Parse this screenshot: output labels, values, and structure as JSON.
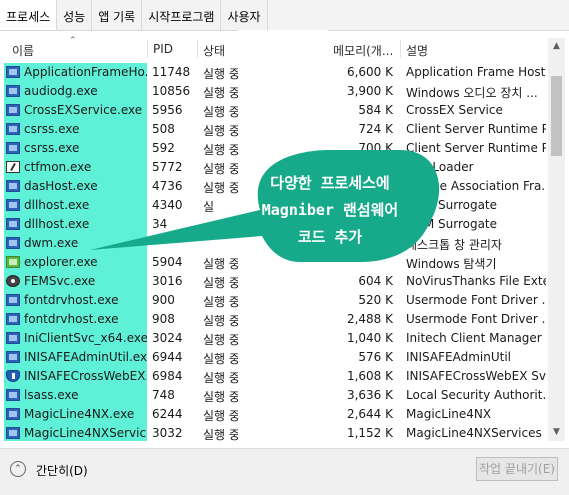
{
  "tabs": [
    "프로세스",
    "성능",
    "앱 기록",
    "시작프로그램",
    "사용자"
  ],
  "columns": {
    "name": "이름",
    "pid": "PID",
    "status": "상태",
    "memory": "메모리(개...",
    "description": "설명"
  },
  "rows": [
    {
      "name": "ApplicationFrameHo...",
      "pid": "11748",
      "status": "실행 중",
      "memory": "6,600 K",
      "desc": "Application Frame Host",
      "icon": "app-window-icon"
    },
    {
      "name": "audiodg.exe",
      "pid": "10856",
      "status": "실행 중",
      "memory": "3,900 K",
      "desc": "Windows 오디오 장치 ...",
      "icon": "app-window-icon"
    },
    {
      "name": "CrossEXService.exe",
      "pid": "5956",
      "status": "실행 중",
      "memory": "584 K",
      "desc": "CrossEX Service",
      "icon": "app-window-icon"
    },
    {
      "name": "csrss.exe",
      "pid": "508",
      "status": "실행 중",
      "memory": "724 K",
      "desc": "Client Server Runtime P...",
      "icon": "app-window-icon"
    },
    {
      "name": "csrss.exe",
      "pid": "592",
      "status": "실행 중",
      "memory": "700 K",
      "desc": "Client Server Runtime P...",
      "icon": "app-window-icon"
    },
    {
      "name": "ctfmon.exe",
      "pid": "5772",
      "status": "실행 중",
      "memory": "",
      "desc": "CTF Loader",
      "icon": "pen-icon"
    },
    {
      "name": "dasHost.exe",
      "pid": "4736",
      "status": "실행 중",
      "memory": "",
      "desc": "Device Association Fra...",
      "icon": "app-window-icon"
    },
    {
      "name": "dllhost.exe",
      "pid": "4340",
      "status": "실",
      "memory": "",
      "desc": "COM Surrogate",
      "icon": "app-window-icon"
    },
    {
      "name": "dllhost.exe",
      "pid": "34",
      "status": "",
      "memory": "",
      "desc": "COM Surrogate",
      "icon": "app-window-icon"
    },
    {
      "name": "dwm.exe",
      "pid": "",
      "status": "",
      "memory": "",
      "desc": "데스크톱 창 관리자",
      "icon": "app-window-icon"
    },
    {
      "name": "explorer.exe",
      "pid": "5904",
      "status": "실행 중",
      "memory": "",
      "desc": "Windows 탐색기",
      "icon": "explorer-icon"
    },
    {
      "name": "FEMSvc.exe",
      "pid": "3016",
      "status": "실행 중",
      "memory": "604 K",
      "desc": "NoVirusThanks File Exte...",
      "icon": "gear-icon"
    },
    {
      "name": "fontdrvhost.exe",
      "pid": "900",
      "status": "실행 중",
      "memory": "520 K",
      "desc": "Usermode Font Driver ...",
      "icon": "app-window-icon"
    },
    {
      "name": "fontdrvhost.exe",
      "pid": "908",
      "status": "실행 중",
      "memory": "2,488 K",
      "desc": "Usermode Font Driver ...",
      "icon": "app-window-icon"
    },
    {
      "name": "IniClientSvc_x64.exe",
      "pid": "3024",
      "status": "실행 중",
      "memory": "1,040 K",
      "desc": "Initech Client Manager ...",
      "icon": "app-window-icon"
    },
    {
      "name": "INISAFEAdminUtil.exe",
      "pid": "6944",
      "status": "실행 중",
      "memory": "576 K",
      "desc": "INISAFEAdminUtil",
      "icon": "app-window-icon"
    },
    {
      "name": "INISAFECrossWebEX...",
      "pid": "6984",
      "status": "실행 중",
      "memory": "1,608 K",
      "desc": "INISAFECrossWebEX Svc",
      "icon": "shield-icon"
    },
    {
      "name": "lsass.exe",
      "pid": "748",
      "status": "실행 중",
      "memory": "3,636 K",
      "desc": "Local Security Authorit...",
      "icon": "app-window-icon"
    },
    {
      "name": "MagicLine4NX.exe",
      "pid": "6244",
      "status": "실행 중",
      "memory": "2,644 K",
      "desc": "MagicLine4NX",
      "icon": "app-window-icon"
    },
    {
      "name": "MagicLine4NXServic...",
      "pid": "3032",
      "status": "실행 중",
      "memory": "1,152 K",
      "desc": "MagicLine4NXServices",
      "icon": "app-window-icon"
    }
  ],
  "footer": {
    "collapse_label": "간단히(D)",
    "end_task_label": "작업 끝내기(E)"
  },
  "callout": {
    "line1": "다양한 프로세스에",
    "line2": "Magniber 랜섬웨어",
    "line3": "코드 추가",
    "color": "#16a98a"
  },
  "colors": {
    "highlight": "#5ff0d8",
    "callout": "#16a98a"
  }
}
